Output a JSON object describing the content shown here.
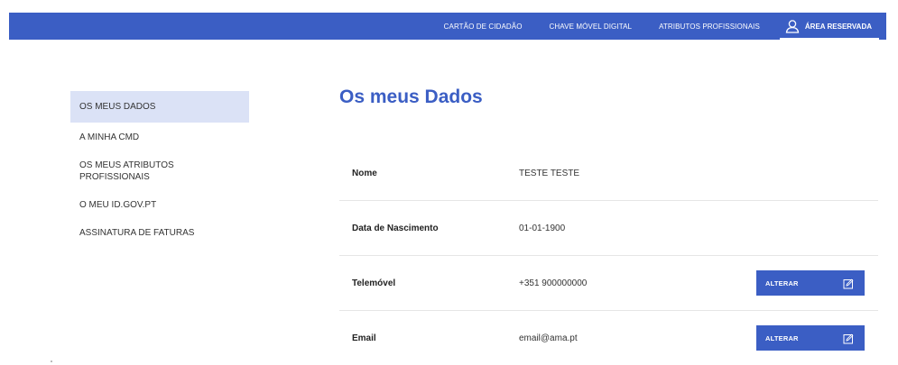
{
  "header": {
    "nav": [
      "CARTÃO DE CIDADÃO",
      "CHAVE MÓVEL DIGITAL",
      "ATRIBUTOS PROFISSIONAIS"
    ],
    "reserved_label": "ÁREA RESERVADA",
    "reserved_icon": "user-icon",
    "color": "#3b5ec4"
  },
  "sidebar": {
    "items": [
      {
        "label": "OS MEUS DADOS",
        "active": true
      },
      {
        "label": "A MINHA CMD"
      },
      {
        "label": "OS MEUS ATRIBUTOS PROFISSIONAIS"
      },
      {
        "label": "O MEU ID.GOV.PT"
      },
      {
        "label": "ASSINATURA DE FATURAS"
      }
    ]
  },
  "main": {
    "title": "Os meus Dados",
    "rows": [
      {
        "label": "Nome",
        "value": "TESTE TESTE"
      },
      {
        "label": "Data de Nascimento",
        "value": "01-01-1900"
      },
      {
        "label": "Telemóvel",
        "value": "+351 900000000",
        "button": "ALTERAR",
        "button_icon": "edit-icon"
      },
      {
        "label": "Email",
        "value": "email@ama.pt",
        "button": "ALTERAR",
        "button_icon": "edit-icon"
      }
    ]
  }
}
